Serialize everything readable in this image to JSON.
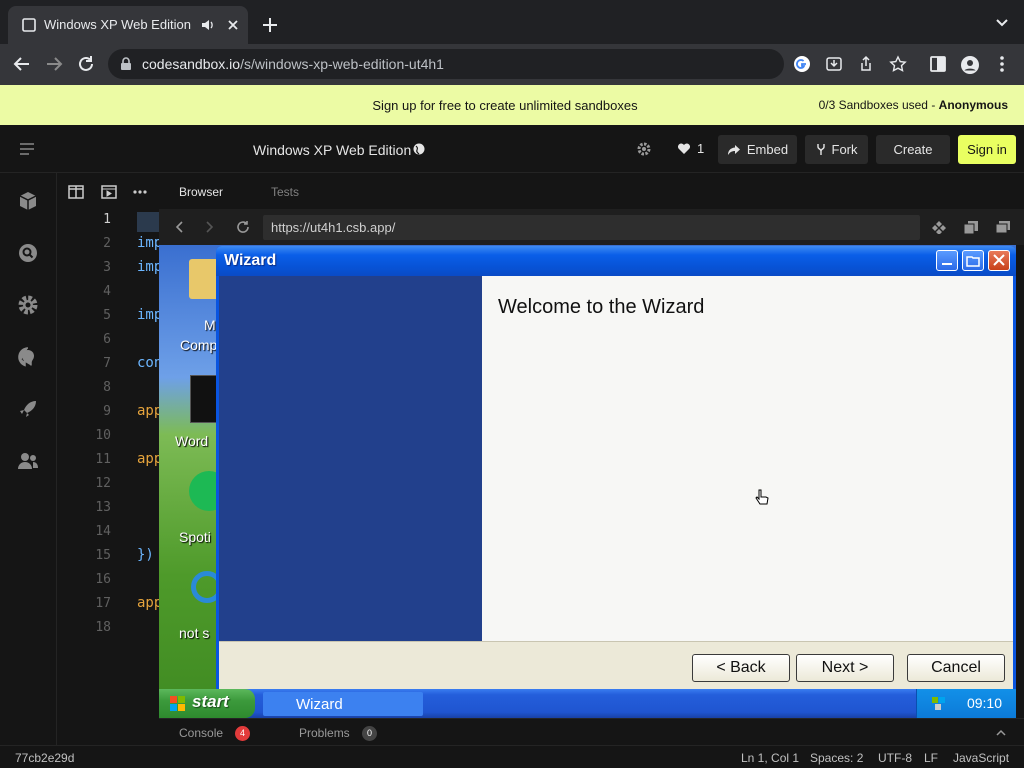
{
  "browser": {
    "tab_title": "Windows XP Web Edition",
    "url_host": "codesandbox.io",
    "url_path": "/s/windows-xp-web-edition-ut4h1"
  },
  "banner": {
    "message": "Sign up for free to create unlimited sandboxes",
    "usage_count": "0/3 Sandboxes used - ",
    "usage_user": "Anonymous"
  },
  "header": {
    "title": "Windows XP Web Edition",
    "like_count": "1",
    "embed_label": "Embed",
    "fork_label": "Fork",
    "create_label": "Create",
    "signin_label": "Sign in"
  },
  "editor": {
    "line_numbers": [
      "1",
      "2",
      "3",
      "4",
      "5",
      "6",
      "7",
      "8",
      "9",
      "10",
      "11",
      "12",
      "13",
      "14",
      "15",
      "16",
      "17",
      "18"
    ],
    "lines": [
      {
        "text": "imp",
        "color": "#6cb6ff",
        "line": 1
      },
      {
        "text": "imp",
        "color": "#6cb6ff",
        "line": 2
      },
      {
        "text": "imp",
        "color": "#6cb6ff",
        "line": 3
      },
      {
        "text": "imp",
        "color": "#6cb6ff",
        "line": 5
      },
      {
        "text": "con",
        "color": "#6cb6ff",
        "line": 7
      },
      {
        "text": "app",
        "color": "#e5a33c",
        "line": 9
      },
      {
        "text": "app",
        "color": "#e5a33c",
        "line": 11
      },
      {
        "text": "})",
        "color": "#6cb6ff",
        "line": 15
      },
      {
        "text": "app",
        "color": "#e5a33c",
        "line": 17
      }
    ]
  },
  "preview": {
    "tab_browser": "Browser",
    "tab_tests": "Tests",
    "url": "https://ut4h1.csb.app/"
  },
  "desktop": {
    "icons": [
      "M",
      "Comp",
      "Word",
      "Spoti",
      "not s"
    ]
  },
  "wizard": {
    "title": "Wizard",
    "heading": "Welcome to the Wizard",
    "back_label": "< Back",
    "next_label": "Next >",
    "cancel_label": "Cancel"
  },
  "taskbar": {
    "start_label": "start",
    "task_label": "Wizard",
    "clock": "09:10"
  },
  "bottom_panel": {
    "console_label": "Console",
    "console_count": "4",
    "problems_label": "Problems",
    "problems_count": "0"
  },
  "status": {
    "commit": "77cb2e29d",
    "position": "Ln 1, Col 1",
    "spaces": "Spaces: 2",
    "encoding": "UTF-8",
    "eol": "LF",
    "language": "JavaScript"
  }
}
